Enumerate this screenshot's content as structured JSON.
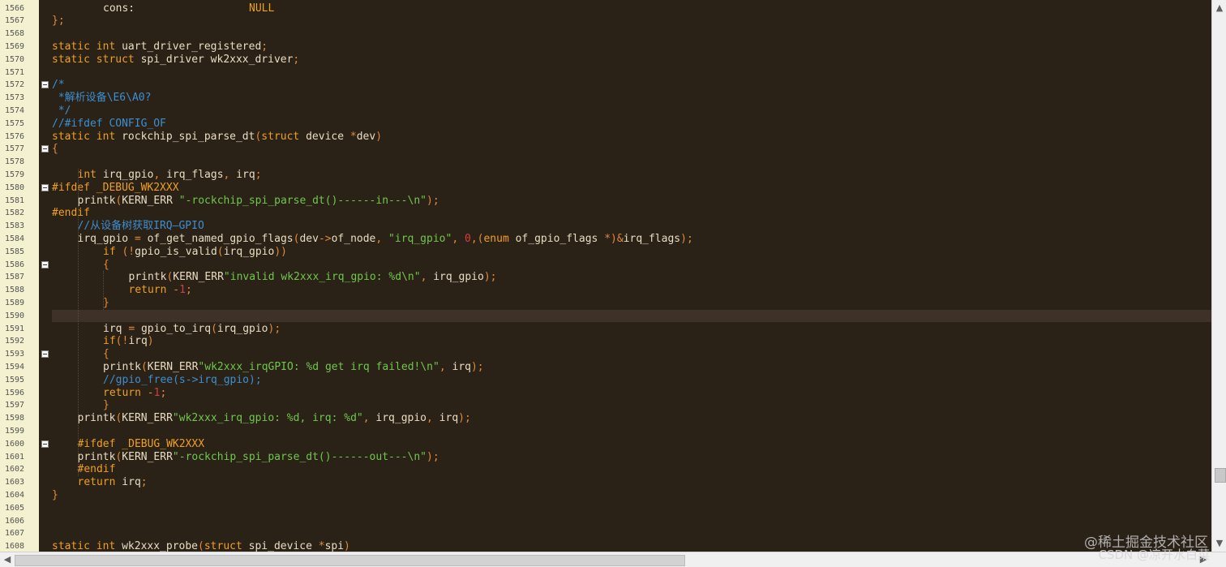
{
  "editor": {
    "current_line": "1590",
    "fold_markers": [
      "1572",
      "1577",
      "1580",
      "1586",
      "1593",
      "1600"
    ],
    "colors": {
      "background": "#2a2117",
      "gutter": "#f3f1cf",
      "keyword": "#f0a020",
      "text": "#e8dcc2",
      "comment": "#3d8fd0",
      "string": "#6fc84a",
      "number": "#d04040"
    },
    "lines": [
      {
        "n": "1566",
        "i": 2,
        "t": [
          [
            "tx",
            "cons:                  "
          ],
          [
            "kw",
            "NULL"
          ]
        ]
      },
      {
        "n": "1567",
        "i": 0,
        "t": [
          [
            "pu",
            "};"
          ]
        ]
      },
      {
        "n": "1568",
        "i": 0,
        "t": []
      },
      {
        "n": "1569",
        "i": 0,
        "t": [
          [
            "kw",
            "static int "
          ],
          [
            "tx",
            "uart_driver_registered"
          ],
          [
            "pu",
            ";"
          ]
        ]
      },
      {
        "n": "1570",
        "i": 0,
        "t": [
          [
            "kw",
            "static struct "
          ],
          [
            "tx",
            "spi_driver wk2xxx_driver"
          ],
          [
            "pu",
            ";"
          ]
        ]
      },
      {
        "n": "1571",
        "i": 0,
        "t": []
      },
      {
        "n": "1572",
        "i": 0,
        "t": [
          [
            "cm",
            "/*"
          ]
        ]
      },
      {
        "n": "1573",
        "i": 0,
        "t": [
          [
            "cm",
            " *解析设备\\E6\\A0?"
          ]
        ]
      },
      {
        "n": "1574",
        "i": 0,
        "t": [
          [
            "cm",
            " */"
          ]
        ]
      },
      {
        "n": "1575",
        "i": 0,
        "t": [
          [
            "cm",
            "//#ifdef CONFIG_OF"
          ]
        ]
      },
      {
        "n": "1576",
        "i": 0,
        "t": [
          [
            "kw",
            "static int "
          ],
          [
            "tx",
            "rockchip_spi_parse_dt"
          ],
          [
            "pu",
            "("
          ],
          [
            "kw",
            "struct "
          ],
          [
            "tx",
            "device "
          ],
          [
            "pu",
            "*"
          ],
          [
            "tx",
            "dev"
          ],
          [
            "pu",
            ")"
          ]
        ]
      },
      {
        "n": "1577",
        "i": 0,
        "t": [
          [
            "pu",
            "{"
          ]
        ]
      },
      {
        "n": "1578",
        "i": 0,
        "t": []
      },
      {
        "n": "1579",
        "i": 1,
        "t": [
          [
            "kw",
            "int "
          ],
          [
            "tx",
            "irq_gpio"
          ],
          [
            "pu",
            ", "
          ],
          [
            "tx",
            "irq_flags"
          ],
          [
            "pu",
            ", "
          ],
          [
            "tx",
            "irq"
          ],
          [
            "pu",
            ";"
          ]
        ]
      },
      {
        "n": "1580",
        "i": 0,
        "t": [
          [
            "pp",
            "#ifdef _DEBUG_WK2XXX"
          ]
        ]
      },
      {
        "n": "1581",
        "i": 1,
        "t": [
          [
            "tx",
            "printk"
          ],
          [
            "pu",
            "("
          ],
          [
            "tx",
            "KERN_ERR "
          ],
          [
            "st",
            "\"-rockchip_spi_parse_dt()------in---\\n\""
          ],
          [
            "pu",
            ");"
          ]
        ]
      },
      {
        "n": "1582",
        "i": 0,
        "t": [
          [
            "pp",
            "#endif"
          ]
        ]
      },
      {
        "n": "1583",
        "i": 1,
        "t": [
          [
            "cm",
            "//从设备树获取IRQ—GPIO"
          ]
        ]
      },
      {
        "n": "1584",
        "i": 1,
        "t": [
          [
            "tx",
            "irq_gpio "
          ],
          [
            "pu",
            "= "
          ],
          [
            "tx",
            "of_get_named_gpio_flags"
          ],
          [
            "pu",
            "("
          ],
          [
            "tx",
            "dev"
          ],
          [
            "pu",
            "->"
          ],
          [
            "tx",
            "of_node"
          ],
          [
            "pu",
            ", "
          ],
          [
            "st",
            "\"irq_gpio\""
          ],
          [
            "pu",
            ", "
          ],
          [
            "nu",
            "0"
          ],
          [
            "pu",
            ",("
          ],
          [
            "kw",
            "enum "
          ],
          [
            "tx",
            "of_gpio_flags "
          ],
          [
            "pu",
            "*)&"
          ],
          [
            "tx",
            "irq_flags"
          ],
          [
            "pu",
            ");"
          ]
        ]
      },
      {
        "n": "1585",
        "i": 2,
        "t": [
          [
            "kw",
            "if "
          ],
          [
            "pu",
            "(!"
          ],
          [
            "tx",
            "gpio_is_valid"
          ],
          [
            "pu",
            "("
          ],
          [
            "tx",
            "irq_gpio"
          ],
          [
            "pu",
            "))"
          ]
        ]
      },
      {
        "n": "1586",
        "i": 2,
        "t": [
          [
            "pu",
            "{"
          ]
        ]
      },
      {
        "n": "1587",
        "i": 3,
        "t": [
          [
            "tx",
            "printk"
          ],
          [
            "pu",
            "("
          ],
          [
            "tx",
            "KERN_ERR"
          ],
          [
            "st",
            "\"invalid wk2xxx_irq_gpio: %d\\n\""
          ],
          [
            "pu",
            ", "
          ],
          [
            "tx",
            "irq_gpio"
          ],
          [
            "pu",
            ");"
          ]
        ]
      },
      {
        "n": "1588",
        "i": 3,
        "t": [
          [
            "kw",
            "return "
          ],
          [
            "pu",
            "-"
          ],
          [
            "nu",
            "1"
          ],
          [
            "pu",
            ";"
          ]
        ]
      },
      {
        "n": "1589",
        "i": 2,
        "t": [
          [
            "pu",
            "}"
          ]
        ]
      },
      {
        "n": "1590",
        "i": 0,
        "t": []
      },
      {
        "n": "1591",
        "i": 2,
        "t": [
          [
            "tx",
            "irq "
          ],
          [
            "pu",
            "= "
          ],
          [
            "tx",
            "gpio_to_irq"
          ],
          [
            "pu",
            "("
          ],
          [
            "tx",
            "irq_gpio"
          ],
          [
            "pu",
            ");"
          ]
        ]
      },
      {
        "n": "1592",
        "i": 2,
        "t": [
          [
            "kw",
            "if"
          ],
          [
            "pu",
            "(!"
          ],
          [
            "tx",
            "irq"
          ],
          [
            "pu",
            ")"
          ]
        ]
      },
      {
        "n": "1593",
        "i": 2,
        "t": [
          [
            "pu",
            "{"
          ]
        ]
      },
      {
        "n": "1594",
        "i": 2,
        "t": [
          [
            "tx",
            "printk"
          ],
          [
            "pu",
            "("
          ],
          [
            "tx",
            "KERN_ERR"
          ],
          [
            "st",
            "\"wk2xxx_irqGPIO: %d get irq failed!\\n\""
          ],
          [
            "pu",
            ", "
          ],
          [
            "tx",
            "irq"
          ],
          [
            "pu",
            ");"
          ]
        ]
      },
      {
        "n": "1595",
        "i": 2,
        "t": [
          [
            "cm",
            "//gpio_free(s->irq_gpio);"
          ]
        ]
      },
      {
        "n": "1596",
        "i": 2,
        "t": [
          [
            "kw",
            "return "
          ],
          [
            "pu",
            "-"
          ],
          [
            "nu",
            "1"
          ],
          [
            "pu",
            ";"
          ]
        ]
      },
      {
        "n": "1597",
        "i": 2,
        "t": [
          [
            "pu",
            "}"
          ]
        ]
      },
      {
        "n": "1598",
        "i": 1,
        "t": [
          [
            "tx",
            "printk"
          ],
          [
            "pu",
            "("
          ],
          [
            "tx",
            "KERN_ERR"
          ],
          [
            "st",
            "\"wk2xxx_irq_gpio: %d, irq: %d\""
          ],
          [
            "pu",
            ", "
          ],
          [
            "tx",
            "irq_gpio"
          ],
          [
            "pu",
            ", "
          ],
          [
            "tx",
            "irq"
          ],
          [
            "pu",
            ");"
          ]
        ]
      },
      {
        "n": "1599",
        "i": 0,
        "t": []
      },
      {
        "n": "1600",
        "i": 1,
        "t": [
          [
            "pp",
            "#ifdef _DEBUG_WK2XXX"
          ]
        ]
      },
      {
        "n": "1601",
        "i": 1,
        "t": [
          [
            "tx",
            "printk"
          ],
          [
            "pu",
            "("
          ],
          [
            "tx",
            "KERN_ERR"
          ],
          [
            "st",
            "\"-rockchip_spi_parse_dt()------out---\\n\""
          ],
          [
            "pu",
            ");"
          ]
        ]
      },
      {
        "n": "1602",
        "i": 1,
        "t": [
          [
            "pp",
            "#endif"
          ]
        ]
      },
      {
        "n": "1603",
        "i": 1,
        "t": [
          [
            "kw",
            "return "
          ],
          [
            "tx",
            "irq"
          ],
          [
            "pu",
            ";"
          ]
        ]
      },
      {
        "n": "1604",
        "i": 0,
        "t": [
          [
            "pu",
            "}"
          ]
        ]
      },
      {
        "n": "1605",
        "i": 0,
        "t": []
      },
      {
        "n": "1606",
        "i": 0,
        "t": []
      },
      {
        "n": "1607",
        "i": 0,
        "t": []
      },
      {
        "n": "1608",
        "i": 0,
        "t": [
          [
            "kw",
            "static int "
          ],
          [
            "tx",
            "wk2xxx_probe"
          ],
          [
            "pu",
            "("
          ],
          [
            "kw",
            "struct "
          ],
          [
            "tx",
            "spi_device "
          ],
          [
            "pu",
            "*"
          ],
          [
            "tx",
            "spi"
          ],
          [
            "pu",
            ")"
          ]
        ]
      }
    ]
  },
  "watermark": {
    "line1": "@稀土掘金技术社区",
    "line2": "CSDN @凉开水白菜"
  },
  "scrollbar": {
    "up": "▲",
    "down": "▼",
    "left": "◀",
    "right": "▶"
  }
}
